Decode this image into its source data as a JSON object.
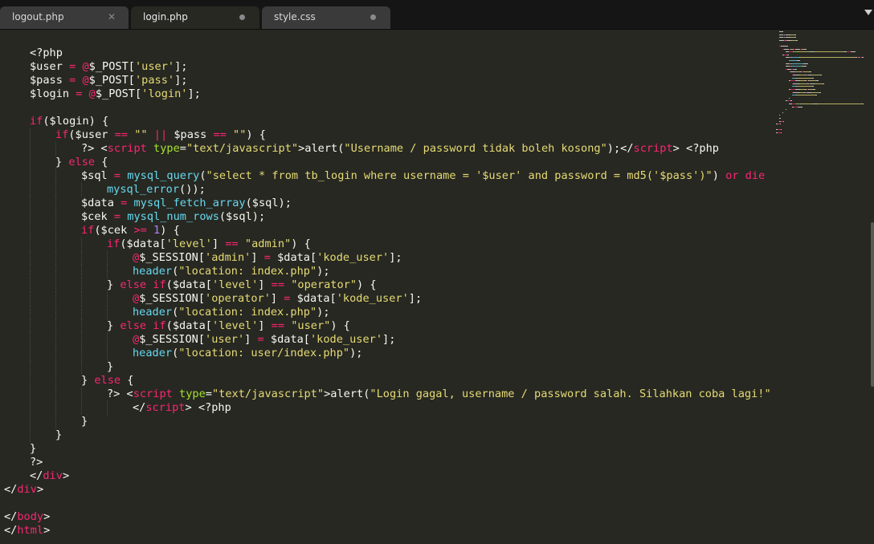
{
  "tabs": [
    {
      "label": "logout.php",
      "active": false,
      "control": "close"
    },
    {
      "label": "login.php",
      "active": true,
      "control": "modified"
    },
    {
      "label": "style.css",
      "active": false,
      "control": "modified"
    }
  ],
  "tab_bar": {
    "dropdown_icon": "chevron-down-icon"
  },
  "colors": {
    "background": "#272822",
    "keyword": "#f92672",
    "string": "#e6db74",
    "function": "#66d9ef",
    "number": "#ae81ff",
    "attribute": "#a6e22e",
    "plain": "#f8f8f2"
  },
  "code": [
    {
      "indent": 1,
      "tokens": [
        [
          "pl",
          "<?php"
        ]
      ]
    },
    {
      "indent": 1,
      "tokens": [
        [
          "pl",
          "$user "
        ],
        [
          "kw",
          "="
        ],
        [
          "pl",
          " "
        ],
        [
          "kw",
          "@"
        ],
        [
          "pl",
          "$_POST["
        ],
        [
          "str",
          "'user'"
        ],
        [
          "pl",
          "];"
        ]
      ]
    },
    {
      "indent": 1,
      "tokens": [
        [
          "pl",
          "$pass "
        ],
        [
          "kw",
          "="
        ],
        [
          "pl",
          " "
        ],
        [
          "kw",
          "@"
        ],
        [
          "pl",
          "$_POST["
        ],
        [
          "str",
          "'pass'"
        ],
        [
          "pl",
          "];"
        ]
      ]
    },
    {
      "indent": 1,
      "tokens": [
        [
          "pl",
          "$login "
        ],
        [
          "kw",
          "="
        ],
        [
          "pl",
          " "
        ],
        [
          "kw",
          "@"
        ],
        [
          "pl",
          "$_POST["
        ],
        [
          "str",
          "'login'"
        ],
        [
          "pl",
          "];"
        ]
      ]
    },
    {
      "indent": 0,
      "tokens": []
    },
    {
      "indent": 1,
      "tokens": [
        [
          "kw",
          "if"
        ],
        [
          "pl",
          "($login) {"
        ]
      ]
    },
    {
      "indent": 2,
      "tokens": [
        [
          "kw",
          "if"
        ],
        [
          "pl",
          "($user "
        ],
        [
          "kw",
          "=="
        ],
        [
          "pl",
          " "
        ],
        [
          "str",
          "\"\""
        ],
        [
          "pl",
          " "
        ],
        [
          "kw",
          "||"
        ],
        [
          "pl",
          " $pass "
        ],
        [
          "kw",
          "=="
        ],
        [
          "pl",
          " "
        ],
        [
          "str",
          "\"\""
        ],
        [
          "pl",
          ") {"
        ]
      ]
    },
    {
      "indent": 3,
      "tokens": [
        [
          "pl",
          "?> <"
        ],
        [
          "kw",
          "script"
        ],
        [
          "pl",
          " "
        ],
        [
          "attr",
          "type"
        ],
        [
          "pl",
          "="
        ],
        [
          "str",
          "\"text/javascript\""
        ],
        [
          "pl",
          ">alert("
        ],
        [
          "str",
          "\"Username / password tidak boleh kosong\""
        ],
        [
          "pl",
          ");</"
        ],
        [
          "kw",
          "script"
        ],
        [
          "pl",
          "> <?php"
        ]
      ]
    },
    {
      "indent": 2,
      "tokens": [
        [
          "pl",
          "} "
        ],
        [
          "kw",
          "else"
        ],
        [
          "pl",
          " {"
        ]
      ]
    },
    {
      "indent": 3,
      "tokens": [
        [
          "pl",
          "$sql "
        ],
        [
          "kw",
          "="
        ],
        [
          "pl",
          " "
        ],
        [
          "fn",
          "mysql_query"
        ],
        [
          "pl",
          "("
        ],
        [
          "str",
          "\"select * from tb_login where username = '$user' and password = md5('$pass')\""
        ],
        [
          "pl",
          ") "
        ],
        [
          "kw",
          "or"
        ],
        [
          "pl",
          " "
        ],
        [
          "kw",
          "die"
        ],
        [
          "pl",
          " ("
        ]
      ]
    },
    {
      "indent": 4,
      "tokens": [
        [
          "fn",
          "mysql_error"
        ],
        [
          "pl",
          "());"
        ]
      ]
    },
    {
      "indent": 3,
      "tokens": [
        [
          "pl",
          "$data "
        ],
        [
          "kw",
          "="
        ],
        [
          "pl",
          " "
        ],
        [
          "fn",
          "mysql_fetch_array"
        ],
        [
          "pl",
          "($sql);"
        ]
      ]
    },
    {
      "indent": 3,
      "tokens": [
        [
          "pl",
          "$cek "
        ],
        [
          "kw",
          "="
        ],
        [
          "pl",
          " "
        ],
        [
          "fn",
          "mysql_num_rows"
        ],
        [
          "pl",
          "($sql);"
        ]
      ]
    },
    {
      "indent": 3,
      "tokens": [
        [
          "kw",
          "if"
        ],
        [
          "pl",
          "($cek "
        ],
        [
          "kw",
          ">="
        ],
        [
          "pl",
          " "
        ],
        [
          "num",
          "1"
        ],
        [
          "pl",
          ") {"
        ]
      ]
    },
    {
      "indent": 4,
      "tokens": [
        [
          "kw",
          "if"
        ],
        [
          "pl",
          "($data["
        ],
        [
          "str",
          "'level'"
        ],
        [
          "pl",
          "] "
        ],
        [
          "kw",
          "=="
        ],
        [
          "pl",
          " "
        ],
        [
          "str",
          "\"admin\""
        ],
        [
          "pl",
          ") {"
        ]
      ]
    },
    {
      "indent": 5,
      "tokens": [
        [
          "kw",
          "@"
        ],
        [
          "pl",
          "$_SESSION["
        ],
        [
          "str",
          "'admin'"
        ],
        [
          "pl",
          "] "
        ],
        [
          "kw",
          "="
        ],
        [
          "pl",
          " $data["
        ],
        [
          "str",
          "'kode_user'"
        ],
        [
          "pl",
          "];"
        ]
      ]
    },
    {
      "indent": 5,
      "tokens": [
        [
          "fn",
          "header"
        ],
        [
          "pl",
          "("
        ],
        [
          "str",
          "\"location: index.php\""
        ],
        [
          "pl",
          ");"
        ]
      ]
    },
    {
      "indent": 4,
      "tokens": [
        [
          "pl",
          "} "
        ],
        [
          "kw",
          "else if"
        ],
        [
          "pl",
          "($data["
        ],
        [
          "str",
          "'level'"
        ],
        [
          "pl",
          "] "
        ],
        [
          "kw",
          "=="
        ],
        [
          "pl",
          " "
        ],
        [
          "str",
          "\"operator\""
        ],
        [
          "pl",
          ") {"
        ]
      ]
    },
    {
      "indent": 5,
      "tokens": [
        [
          "kw",
          "@"
        ],
        [
          "pl",
          "$_SESSION["
        ],
        [
          "str",
          "'operator'"
        ],
        [
          "pl",
          "] "
        ],
        [
          "kw",
          "="
        ],
        [
          "pl",
          " $data["
        ],
        [
          "str",
          "'kode_user'"
        ],
        [
          "pl",
          "];"
        ]
      ]
    },
    {
      "indent": 5,
      "tokens": [
        [
          "fn",
          "header"
        ],
        [
          "pl",
          "("
        ],
        [
          "str",
          "\"location: index.php\""
        ],
        [
          "pl",
          ");"
        ]
      ]
    },
    {
      "indent": 4,
      "tokens": [
        [
          "pl",
          "} "
        ],
        [
          "kw",
          "else if"
        ],
        [
          "pl",
          "($data["
        ],
        [
          "str",
          "'level'"
        ],
        [
          "pl",
          "] "
        ],
        [
          "kw",
          "=="
        ],
        [
          "pl",
          " "
        ],
        [
          "str",
          "\"user\""
        ],
        [
          "pl",
          ") {"
        ]
      ]
    },
    {
      "indent": 5,
      "tokens": [
        [
          "kw",
          "@"
        ],
        [
          "pl",
          "$_SESSION["
        ],
        [
          "str",
          "'user'"
        ],
        [
          "pl",
          "] "
        ],
        [
          "kw",
          "="
        ],
        [
          "pl",
          " $data["
        ],
        [
          "str",
          "'kode_user'"
        ],
        [
          "pl",
          "];"
        ]
      ]
    },
    {
      "indent": 5,
      "tokens": [
        [
          "fn",
          "header"
        ],
        [
          "pl",
          "("
        ],
        [
          "str",
          "\"location: user/index.php\""
        ],
        [
          "pl",
          ");"
        ]
      ]
    },
    {
      "indent": 4,
      "tokens": [
        [
          "pl",
          "}"
        ]
      ]
    },
    {
      "indent": 3,
      "tokens": [
        [
          "pl",
          "} "
        ],
        [
          "kw",
          "else"
        ],
        [
          "pl",
          " {"
        ]
      ]
    },
    {
      "indent": 4,
      "tokens": [
        [
          "pl",
          "?> <"
        ],
        [
          "kw",
          "script"
        ],
        [
          "pl",
          " "
        ],
        [
          "attr",
          "type"
        ],
        [
          "pl",
          "="
        ],
        [
          "str",
          "\"text/javascript\""
        ],
        [
          "pl",
          ">alert("
        ],
        [
          "str",
          "\"Login gagal, username / password salah. Silahkan coba lagi!\""
        ],
        [
          "pl",
          ");"
        ]
      ]
    },
    {
      "indent": 5,
      "tokens": [
        [
          "pl",
          "</"
        ],
        [
          "kw",
          "script"
        ],
        [
          "pl",
          "> <?php"
        ]
      ]
    },
    {
      "indent": 3,
      "tokens": [
        [
          "pl",
          "}"
        ]
      ]
    },
    {
      "indent": 2,
      "tokens": [
        [
          "pl",
          "}"
        ]
      ]
    },
    {
      "indent": 1,
      "tokens": [
        [
          "pl",
          "}"
        ]
      ]
    },
    {
      "indent": 1,
      "tokens": [
        [
          "pl",
          "?>"
        ]
      ]
    },
    {
      "indent": 1,
      "tokens": [
        [
          "pl",
          "</"
        ],
        [
          "kw",
          "div"
        ],
        [
          "pl",
          ">"
        ]
      ]
    },
    {
      "indent": 0,
      "tokens": [
        [
          "pl",
          "</"
        ],
        [
          "kw",
          "div"
        ],
        [
          "pl",
          ">"
        ]
      ]
    },
    {
      "indent": 0,
      "tokens": []
    },
    {
      "indent": 0,
      "tokens": [
        [
          "pl",
          "</"
        ],
        [
          "kw",
          "body"
        ],
        [
          "pl",
          ">"
        ]
      ]
    },
    {
      "indent": 0,
      "tokens": [
        [
          "pl",
          "</"
        ],
        [
          "kw",
          "html"
        ],
        [
          "pl",
          ">"
        ]
      ]
    }
  ]
}
